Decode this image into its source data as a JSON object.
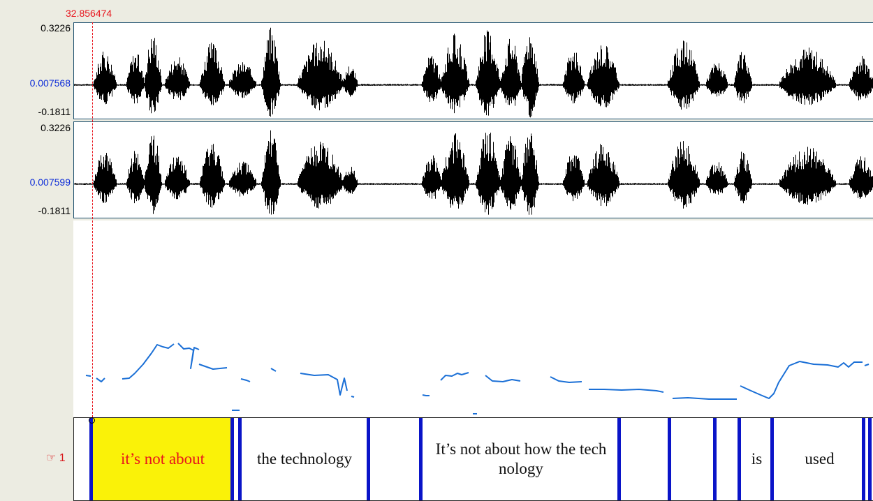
{
  "cursor": {
    "time": "32.856474"
  },
  "channels": [
    {
      "max_label": "0.3226",
      "mid_label": "0.007568",
      "min_label": "-0.1811"
    },
    {
      "max_label": "0.3226",
      "mid_label": "0.007599",
      "min_label": "-0.1811"
    }
  ],
  "tier": {
    "marker": "☞ 1",
    "segments": [
      {
        "text": "it’s not about",
        "selected": true
      },
      {
        "text": "the technology",
        "selected": false
      },
      {
        "text": "It’s not about how the tech nology",
        "selected": false
      },
      {
        "text": "is",
        "selected": false
      },
      {
        "text": "used",
        "selected": false
      }
    ]
  },
  "colors": {
    "waveform": "#000000",
    "pitch": "#1a6fd6",
    "boundary": "#0a14c8",
    "selection": "#faf208",
    "cursor": "#e8141c"
  }
}
